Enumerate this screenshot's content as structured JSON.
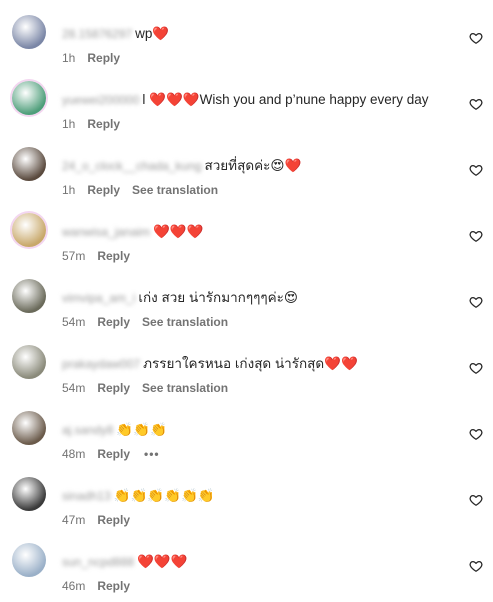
{
  "comments": [
    {
      "username": "28.15876297",
      "text": "wp❤️",
      "time": "1h",
      "reply": "Reply",
      "see_translation": "",
      "avatar_color": "#7a86a6"
    },
    {
      "username": "yuewei200000",
      "text": "l ❤️❤️❤️Wish you and p’nune happy every day",
      "time": "1h",
      "reply": "Reply",
      "see_translation": "",
      "avatar_color": "#4e9e7a"
    },
    {
      "username": "24_o_clock__chada_kung",
      "text": "สวยที่สุดค่ะ😍❤️",
      "time": "1h",
      "reply": "Reply",
      "see_translation": "See translation",
      "avatar_color": "#5a4a3e"
    },
    {
      "username": "wanwisa_janaim",
      "text": "❤️❤️❤️",
      "time": "57m",
      "reply": "Reply",
      "see_translation": "",
      "avatar_color": "#c8a86a"
    },
    {
      "username": "vimvipa_am_i",
      "text": "เก่ง สวย น่ารักมากๆๆๆค่ะ😍",
      "time": "54m",
      "reply": "Reply",
      "see_translation": "See translation",
      "avatar_color": "#6a6a5a"
    },
    {
      "username": "prakaydaw007",
      "text": "ภรรยาใครหนอ เก่งสุด น่ารักสุด❤️❤️",
      "time": "54m",
      "reply": "Reply",
      "see_translation": "See translation",
      "avatar_color": "#8a8a7a"
    },
    {
      "username": "aj.sandy8",
      "text": "👏👏👏",
      "time": "48m",
      "reply": "Reply",
      "see_translation": "",
      "more": "•••",
      "avatar_color": "#6a5a4a"
    },
    {
      "username": "sinadh13",
      "text": "👏👏👏👏👏👏",
      "time": "47m",
      "reply": "Reply",
      "see_translation": "",
      "avatar_color": "#3a3a3a"
    },
    {
      "username": "sun_ncpd888",
      "text": "❤️❤️❤️",
      "time": "46m",
      "reply": "Reply",
      "see_translation": "",
      "avatar_color": "#9ab0c8"
    }
  ]
}
